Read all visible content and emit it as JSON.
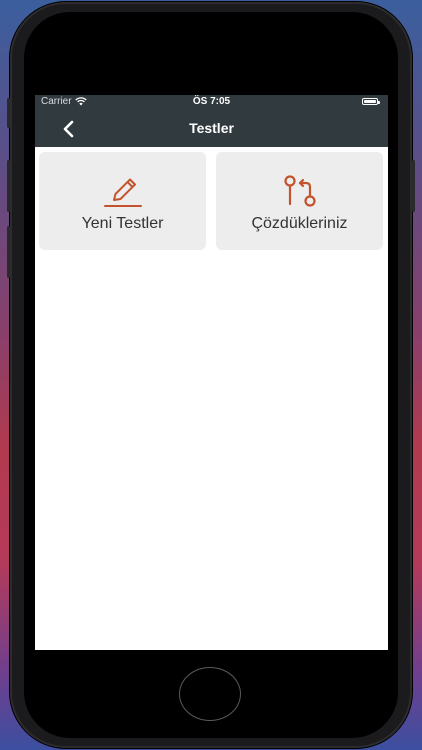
{
  "status_bar": {
    "carrier": "Carrier",
    "time": "ÖS 7:05",
    "battery_level": 1.0
  },
  "nav": {
    "title": "Testler",
    "back_icon": "chevron-left-icon"
  },
  "tiles": [
    {
      "label": "Yeni Testler",
      "icon": "pencil-icon"
    },
    {
      "label": "Çözdükleriniz",
      "icon": "git-pull-request-icon"
    }
  ],
  "colors": {
    "nav_background": "#313a3f",
    "accent": "#c2532d",
    "tile_background": "#ededed"
  }
}
